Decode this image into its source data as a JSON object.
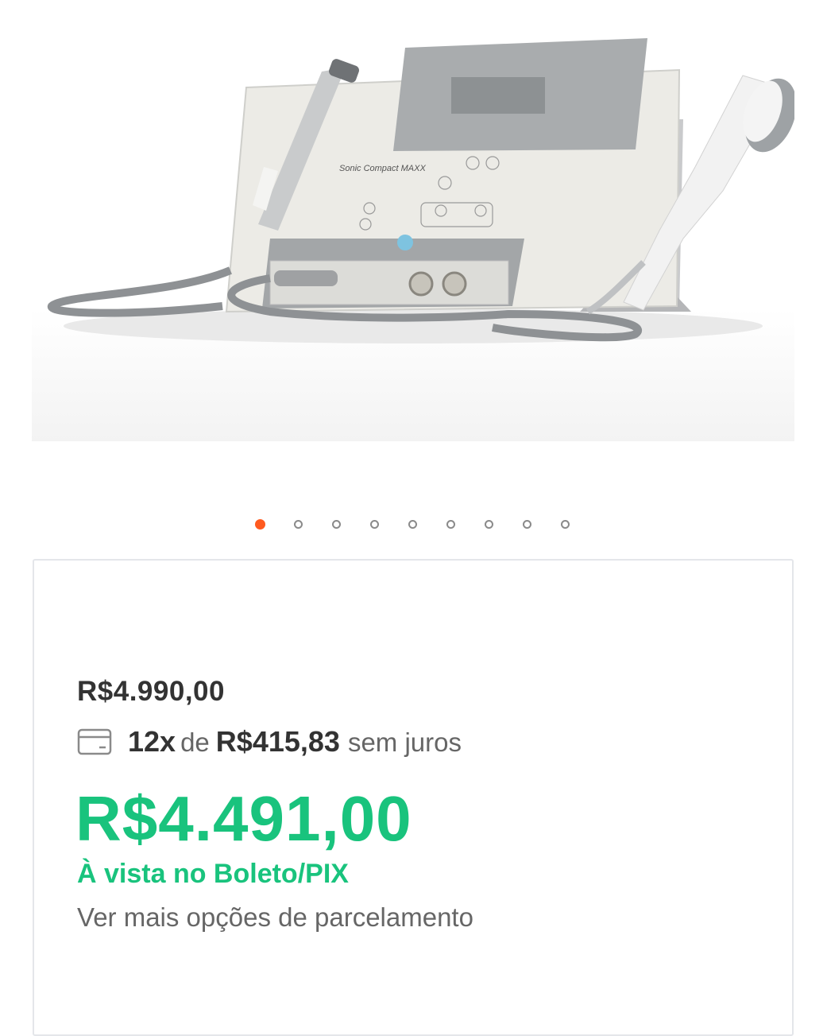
{
  "product": {
    "image_name": "Sonic Compact MAXX",
    "image_alt": "Sonic Compact MAXX"
  },
  "carousel": {
    "count": 9,
    "active_index": 0,
    "active_color": "#ff5a1f"
  },
  "pricing": {
    "old_price": "R$4.990,00",
    "installments": {
      "count_label": "12x",
      "of": "de",
      "value": "R$415,83",
      "interest_free": "sem juros",
      "icon": "credit-card-icon"
    },
    "pix_price": "R$4.491,00",
    "pix_label": "À vista no Boleto/PIX",
    "more_options": "Ver mais opções de parcelamento",
    "accent_color": "#19c37d"
  }
}
